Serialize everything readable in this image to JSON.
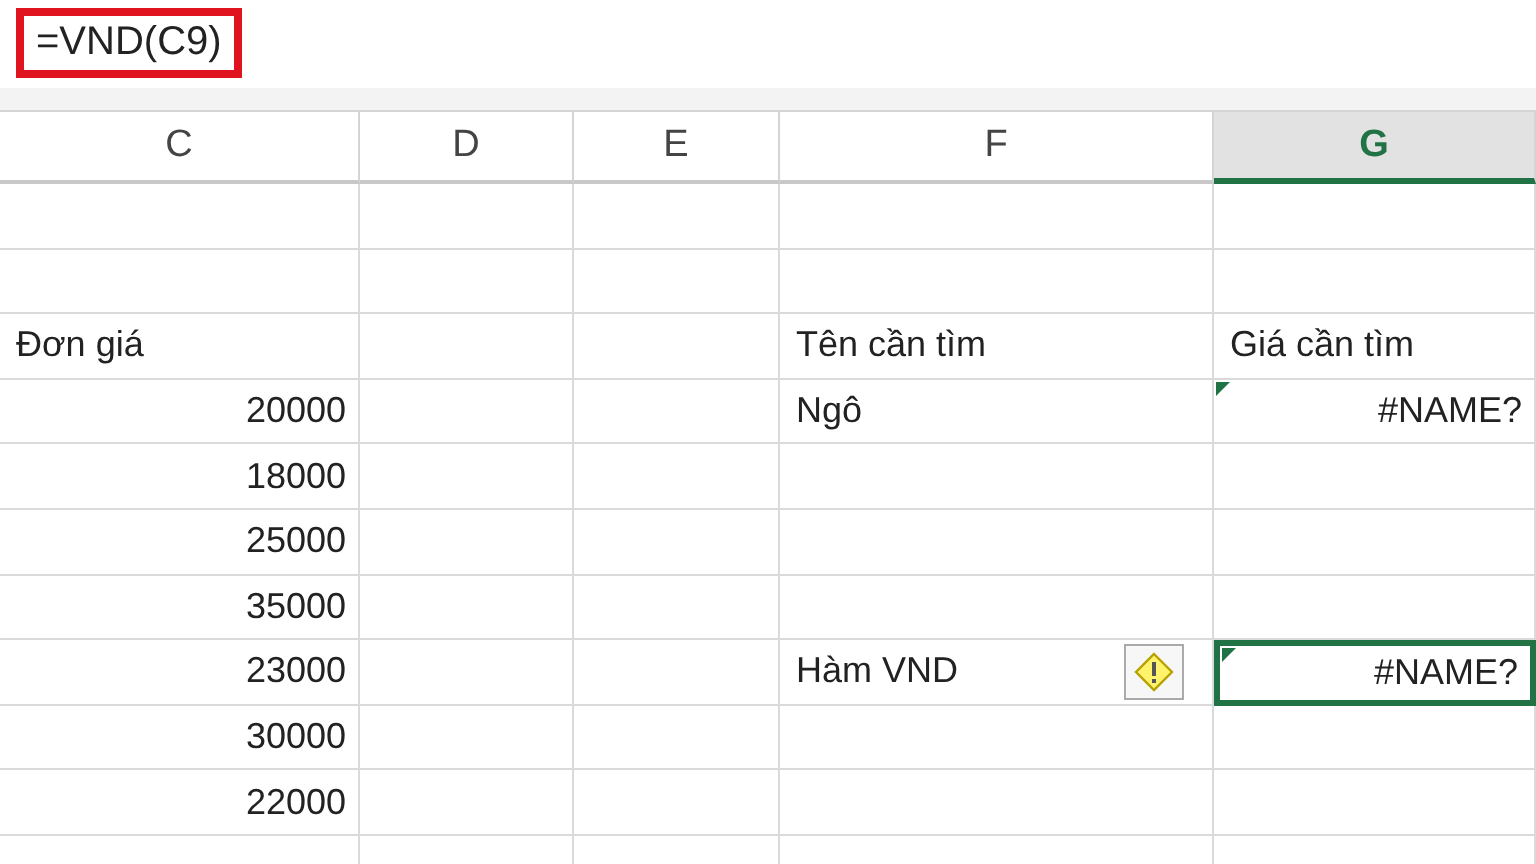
{
  "formula_bar": {
    "formula": "=VND(C9)",
    "highlighted": true
  },
  "columns": [
    {
      "label": "C",
      "selected": false
    },
    {
      "label": "D",
      "selected": false
    },
    {
      "label": "E",
      "selected": false
    },
    {
      "label": "F",
      "selected": false
    },
    {
      "label": "G",
      "selected": true
    }
  ],
  "rows": [
    {},
    {},
    {
      "C": {
        "text": "Đơn giá",
        "kind": "text"
      },
      "F": {
        "text": "Tên cần tìm",
        "kind": "text"
      },
      "G": {
        "text": "Giá cần tìm",
        "kind": "text"
      }
    },
    {
      "C": {
        "text": "20000",
        "kind": "number"
      },
      "F": {
        "text": "Ngô",
        "kind": "text"
      },
      "G": {
        "text": "#NAME?",
        "kind": "error",
        "error_flag": true,
        "selected": false
      }
    },
    {
      "C": {
        "text": "18000",
        "kind": "number"
      }
    },
    {
      "C": {
        "text": "25000",
        "kind": "number"
      }
    },
    {
      "C": {
        "text": "35000",
        "kind": "number"
      }
    },
    {
      "C": {
        "text": "23000",
        "kind": "number"
      },
      "F": {
        "text": "Hàm VND",
        "kind": "text",
        "warning": true
      },
      "G": {
        "text": "#NAME?",
        "kind": "error",
        "error_flag": true,
        "selected": true
      }
    },
    {
      "C": {
        "text": "30000",
        "kind": "number"
      }
    },
    {
      "C": {
        "text": "22000",
        "kind": "number"
      }
    },
    {}
  ]
}
